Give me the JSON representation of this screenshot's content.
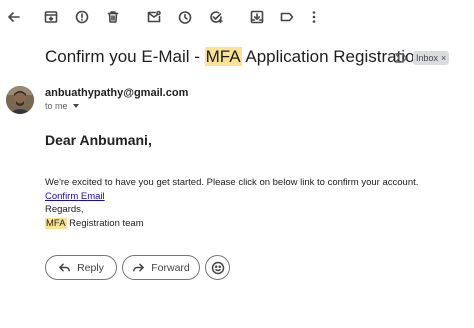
{
  "toolbar": {
    "icons": [
      "back-arrow-icon",
      "archive-icon",
      "report-spam-icon",
      "delete-icon",
      "mark-unread-icon",
      "snooze-icon",
      "add-to-tasks-icon",
      "move-to-icon",
      "label-icon",
      "more-vert-icon"
    ]
  },
  "email": {
    "subject_pre": "Confirm you E-Mail - ",
    "subject_highlight": "MFA",
    "subject_post": " Application Registration",
    "label_badge": "Inbox",
    "label_badge_close": "×",
    "sender": "anbuathypathy@gmail.com",
    "to": "to me",
    "greeting": "Dear Anbumani,",
    "line1": "We're excited to have you get started. Please click on below link to confirm your account.",
    "link": "Confirm Email",
    "regards": "Regards,",
    "team_highlight": "MFA",
    "team_rest": " Registration team"
  },
  "actions": {
    "reply": "Reply",
    "forward": "Forward"
  },
  "colors": {
    "highlight": "#fde293",
    "link": "#1a0dab",
    "badge_bg": "#dadce0"
  }
}
